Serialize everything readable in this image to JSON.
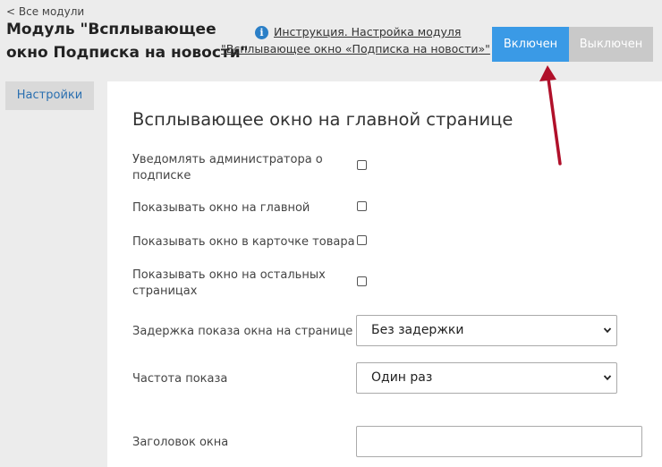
{
  "header": {
    "back_link": "< Все модули",
    "title": "Модуль \"Всплывающее окно Подписка на новости\"",
    "instruction_line1": "Инструкция. Настройка модуля",
    "instruction_line2": "\"Всплывающее окно «Подписка на новости»\"",
    "toggle": {
      "on_label": "Включен",
      "off_label": "Выключен",
      "active": "on",
      "on_color": "#3a9ae6",
      "off_color": "#c9c9c9"
    }
  },
  "sidebar": {
    "items": [
      {
        "label": "Настройки"
      }
    ]
  },
  "main": {
    "section_title": "Всплывающее окно на главной странице",
    "checkboxes": [
      {
        "label": "Уведомлять администратора о подписке",
        "checked": false
      },
      {
        "label": "Показывать окно на главной",
        "checked": false
      },
      {
        "label": "Показывать окно в карточке товара",
        "checked": false
      },
      {
        "label": "Показывать окно на остальных страницах",
        "checked": false
      }
    ],
    "delay": {
      "label": "Задержка показа окна на странице",
      "value": "Без задержки"
    },
    "frequency": {
      "label": "Частота показа",
      "value": "Один раз"
    },
    "window_title": {
      "label": "Заголовок окна",
      "value": ""
    }
  },
  "annotation": {
    "icon": "red-arrow-icon",
    "color": "#b0102a"
  }
}
